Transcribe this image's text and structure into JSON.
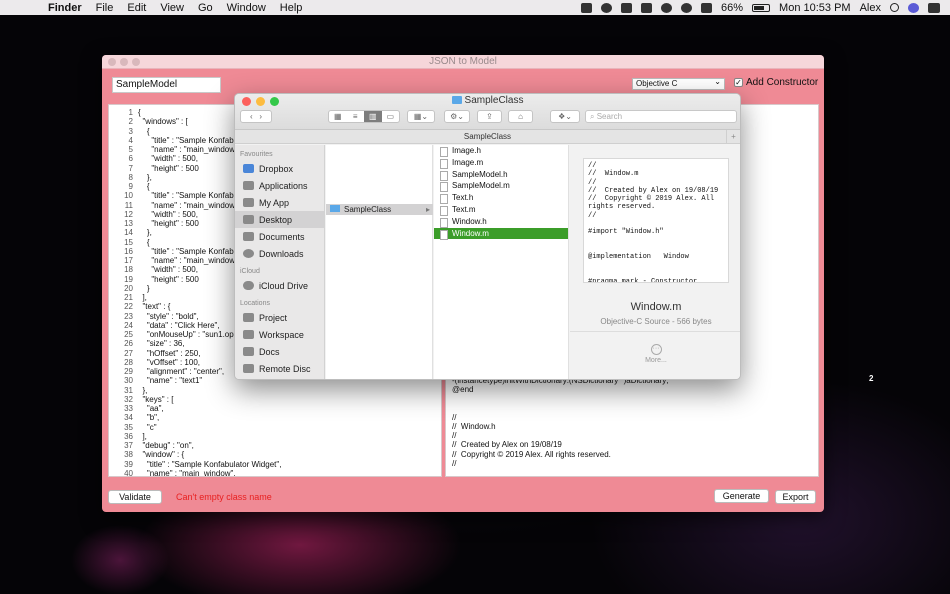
{
  "menubar": {
    "app_name": "Finder",
    "menus": [
      "File",
      "Edit",
      "View",
      "Go",
      "Window",
      "Help"
    ],
    "battery": "66%",
    "clock": "Mon 10:53 PM",
    "user": "Alex"
  },
  "window": {
    "title": "JSON to Model",
    "class_name_value": "SampleModel",
    "language_selected": "Objective C",
    "add_constructor_label": "Add Constructor",
    "add_constructor_checked": true,
    "validate_label": "Validate",
    "error_message": "Can't empty class name",
    "generate_label": "Generate",
    "export_label": "Export",
    "badge_number": "2"
  },
  "editor": {
    "line_numbers": [
      "1",
      "2",
      "3",
      "4",
      "5",
      "6",
      "7",
      "8",
      "9",
      "10",
      "11",
      "12",
      "13",
      "14",
      "15",
      "16",
      "17",
      "18",
      "19",
      "20",
      "21",
      "22",
      "23",
      "24",
      "25",
      "26",
      "27",
      "28",
      "29",
      "30",
      "31",
      "32",
      "33",
      "34",
      "35",
      "36",
      "37",
      "38",
      "39",
      "40"
    ],
    "code": "{\n  \"windows\" : [\n    {\n      \"title\" : \"Sample Konfabulator\n      \"name\" : \"main_window\n      \"width\" : 500,\n      \"height\" : 500\n    },\n    {\n      \"title\" : \"Sample Konfabulator\n      \"name\" : \"main_window\n      \"width\" : 500,\n      \"height\" : 500\n    },\n    {\n      \"title\" : \"Sample Konfabulator\n      \"name\" : \"main_window\n      \"width\" : 500,\n      \"height\" : 500\n    }\n  ],\n  \"text\" : {\n    \"style\" : \"bold\",\n    \"data\" : \"Click Here\",\n    \"onMouseUp\" : \"sun1.opa\n    \"size\" : 36,\n    \"hOffset\" : 250,\n    \"vOffset\" : 100,\n    \"alignment\" : \"center\",\n    \"name\" : \"text1\"\n  },\n  \"keys\" : [\n    \"aa\",\n    \"b\",\n    \"c\"\n  ],\n  \"debug\" : \"on\",\n  \"window\" : {\n    \"title\" : \"Sample Konfabulator Widget\",\n    \"name\" : \"main_window\","
  },
  "output": {
    "code": "-(instancetype)initWithDictionary:(NSDictionary *)aDictionary;\n@end\n\n\n//\n//  Window.h\n//\n//  Created by Alex on 19/08/19\n//  Copyright © 2019 Alex. All rights reserved.\n//"
  },
  "finder": {
    "title": "SampleClass",
    "search_placeholder": "Search",
    "path_title": "SampleClass",
    "sidebar": {
      "favourites_header": "Favourites",
      "favourites": [
        "Dropbox",
        "Applications",
        "My App",
        "Desktop",
        "Documents",
        "Downloads"
      ],
      "selected": "Desktop",
      "icloud_header": "iCloud",
      "icloud": [
        "iCloud Drive"
      ],
      "locations_header": "Locations",
      "locations": [
        "Project",
        "Workspace",
        "Docs",
        "Remote Disc"
      ]
    },
    "column1_selected": "SampleClass",
    "files": [
      "Image.h",
      "Image.m",
      "SampleModel.h",
      "SampleModel.m",
      "Text.h",
      "Text.m",
      "Window.h",
      "Window.m"
    ],
    "selected_file": "Window.m",
    "preview": {
      "text": "//\n//  Window.m\n//\n//  Created by Alex on 19/08/19\n//  Copyright © 2019 Alex. All\nrights reserved.\n//\n\n#import \"Window.h\"\n\n\n@implementation   Window\n\n\n#pragma mark - Constructor",
      "file_name": "Window.m",
      "kind": "Objective-C Source - 566 bytes",
      "more_label": "More..."
    }
  },
  "colors": {
    "window_bg": "#ef8a95",
    "error_text": "#e82020",
    "selection_green": "#3b9d29"
  }
}
